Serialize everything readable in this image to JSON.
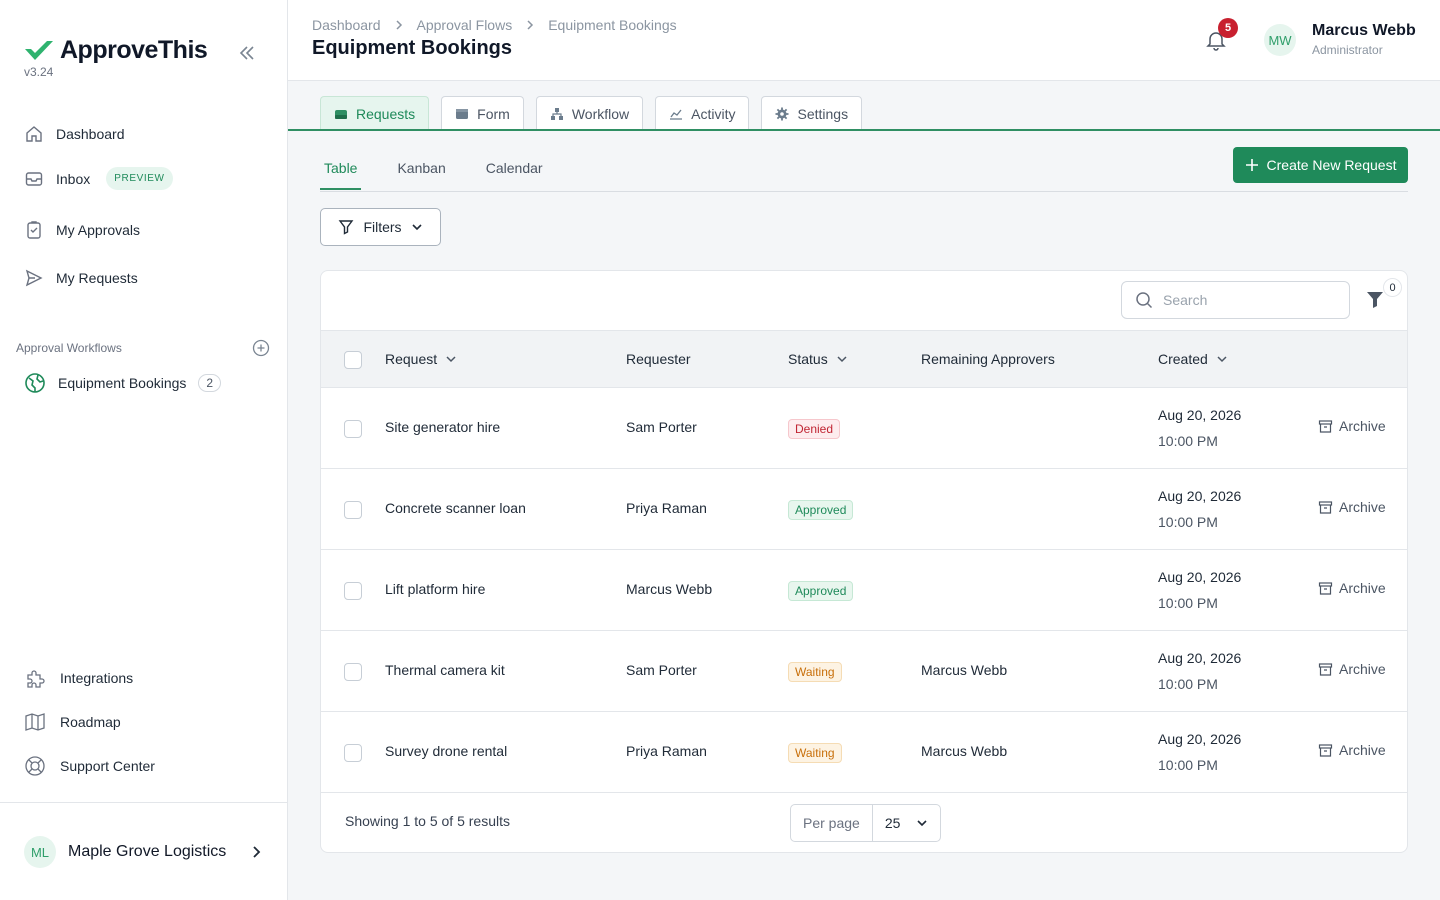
{
  "brand": {
    "name": "ApproveThis",
    "version": "v3.24"
  },
  "sidebar": {
    "nav": [
      {
        "label": "Dashboard"
      },
      {
        "label": "Inbox",
        "badge": "PREVIEW"
      },
      {
        "label": "My Approvals"
      },
      {
        "label": "My Requests"
      }
    ],
    "section_label": "Approval Workflows",
    "workflow": {
      "label": "Equipment Bookings",
      "count": "2"
    },
    "footer_nav": [
      {
        "label": "Integrations"
      },
      {
        "label": "Roadmap"
      },
      {
        "label": "Support Center"
      }
    ],
    "org": {
      "initials": "ML",
      "name": "Maple Grove Logistics"
    }
  },
  "header": {
    "breadcrumb": [
      "Dashboard",
      "Approval Flows",
      "Equipment Bookings"
    ],
    "title": "Equipment Bookings",
    "notifications": "5",
    "user": {
      "initials": "MW",
      "name": "Marcus Webb",
      "role": "Administrator"
    }
  },
  "tabs": [
    "Requests",
    "Form",
    "Workflow",
    "Activity",
    "Settings"
  ],
  "view_tabs": [
    "Table",
    "Kanban",
    "Calendar"
  ],
  "create_button": "Create New Request",
  "filters_button": "Filters",
  "table": {
    "search_placeholder": "Search",
    "filter_count": "0",
    "columns": [
      "Request",
      "Requester",
      "Status",
      "Remaining Approvers",
      "Created"
    ],
    "rows": [
      {
        "request": "Site generator hire",
        "requester": "Sam Porter",
        "status": "Denied",
        "approvers": "",
        "date": "Aug 20, 2026",
        "time": "10:00 PM",
        "action": "Archive"
      },
      {
        "request": "Concrete scanner loan",
        "requester": "Priya Raman",
        "status": "Approved",
        "approvers": "",
        "date": "Aug 20, 2026",
        "time": "10:00 PM",
        "action": "Archive"
      },
      {
        "request": "Lift platform hire",
        "requester": "Marcus Webb",
        "status": "Approved",
        "approvers": "",
        "date": "Aug 20, 2026",
        "time": "10:00 PM",
        "action": "Archive"
      },
      {
        "request": "Thermal camera kit",
        "requester": "Sam Porter",
        "status": "Waiting",
        "approvers": "Marcus Webb",
        "date": "Aug 20, 2026",
        "time": "10:00 PM",
        "action": "Archive"
      },
      {
        "request": "Survey drone rental",
        "requester": "Priya Raman",
        "status": "Waiting",
        "approvers": "Marcus Webb",
        "date": "Aug 20, 2026",
        "time": "10:00 PM",
        "action": "Archive"
      }
    ],
    "footer": "Showing 1 to 5 of 5 results",
    "per_page_label": "Per page",
    "per_page_value": "25"
  },
  "colors": {
    "accent": "#1f8a5a",
    "denied": "#c02533",
    "waiting": "#c86f0a",
    "badge": "#c8202f"
  }
}
